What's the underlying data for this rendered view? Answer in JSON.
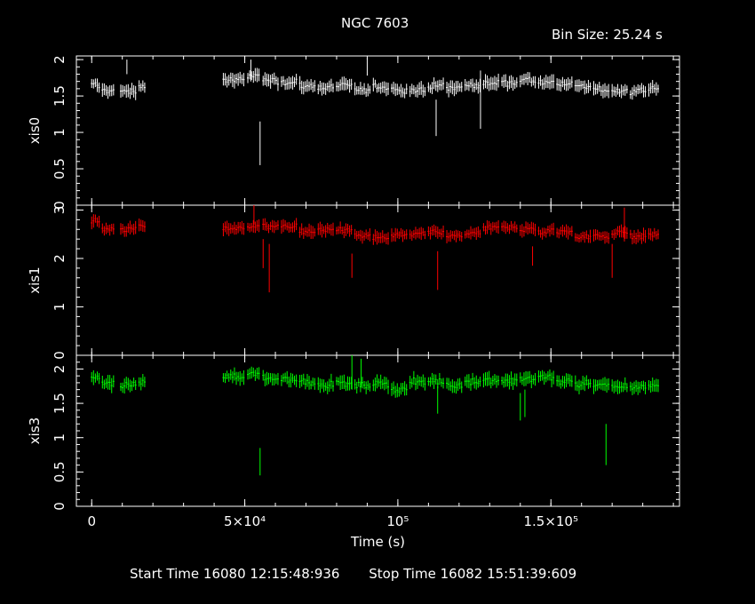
{
  "title": "NGC 7603",
  "bin_size": "Bin Size: 25.24 s",
  "footer": {
    "start_label": "Start Time",
    "start_value": "16080 12:15:48:936",
    "stop_label": "Stop Time",
    "stop_value": "16082 15:51:39:609"
  },
  "colors": {
    "background": "#000000",
    "axes": "#ffffff",
    "xis0": "#ffffff",
    "xis1": "#ff0000",
    "xis3": "#00ff00"
  },
  "chart_data": {
    "type": "scatter",
    "title": "NGC 7603",
    "xlabel": "Time (s)",
    "xlim": [
      -5000,
      192000
    ],
    "x_ticks": [
      {
        "value": 0,
        "label": "0"
      },
      {
        "value": 50000,
        "label": "5×10⁴"
      },
      {
        "value": 100000,
        "label": "10⁵"
      },
      {
        "value": 150000,
        "label": "1.5×10⁵"
      }
    ],
    "gaps": [
      [
        18000,
        42500
      ]
    ],
    "shared_x": true,
    "series": [
      {
        "name": "xis0",
        "color": "#ffffff",
        "ylim": [
          0,
          2.05
        ],
        "y_ticks": [
          "0",
          "0.5",
          "1",
          "1.5",
          "2"
        ],
        "mean": 1.65,
        "noise": 0.09,
        "segments": [
          {
            "x": [
              0,
              2500
            ],
            "y": 1.64
          },
          {
            "x": [
              3500,
              7500
            ],
            "y": 1.58
          },
          {
            "x": [
              9500,
              14500
            ],
            "y": 1.56
          },
          {
            "x": [
              15500,
              17500
            ],
            "y": 1.63
          },
          {
            "x": [
              43000,
              50000
            ],
            "y": 1.72
          },
          {
            "x": [
              51000,
              55000
            ],
            "y": 1.78
          },
          {
            "x": [
              56000,
              61000
            ],
            "y": 1.72
          },
          {
            "x": [
              62000,
              67000
            ],
            "y": 1.7
          },
          {
            "x": [
              68000,
              73000
            ],
            "y": 1.64
          },
          {
            "x": [
              74000,
              79000
            ],
            "y": 1.62
          },
          {
            "x": [
              80000,
              85000
            ],
            "y": 1.64
          },
          {
            "x": [
              86000,
              91000
            ],
            "y": 1.58
          },
          {
            "x": [
              92000,
              97000
            ],
            "y": 1.62
          },
          {
            "x": [
              98000,
              103000
            ],
            "y": 1.6
          },
          {
            "x": [
              104000,
              109000
            ],
            "y": 1.58
          },
          {
            "x": [
              110000,
              115000
            ],
            "y": 1.63
          },
          {
            "x": [
              116000,
              121000
            ],
            "y": 1.62
          },
          {
            "x": [
              122000,
              127000
            ],
            "y": 1.64
          },
          {
            "x": [
              128000,
              133000
            ],
            "y": 1.68
          },
          {
            "x": [
              134000,
              139000
            ],
            "y": 1.7
          },
          {
            "x": [
              140000,
              145000
            ],
            "y": 1.72
          },
          {
            "x": [
              146000,
              151000
            ],
            "y": 1.7
          },
          {
            "x": [
              152000,
              157000
            ],
            "y": 1.68
          },
          {
            "x": [
              158000,
              163000
            ],
            "y": 1.62
          },
          {
            "x": [
              164000,
              169000
            ],
            "y": 1.58
          },
          {
            "x": [
              170000,
              175000
            ],
            "y": 1.58
          },
          {
            "x": [
              176000,
              181000
            ],
            "y": 1.55
          },
          {
            "x": [
              182000,
              185500
            ],
            "y": 1.62
          }
        ],
        "outliers": [
          {
            "x": 55000,
            "y": 0.85,
            "err": 0.3
          },
          {
            "x": 112500,
            "y": 1.2,
            "err": 0.25
          },
          {
            "x": 127000,
            "y": 1.45,
            "err": 0.4
          },
          {
            "x": 11500,
            "y": 1.9,
            "err": 0.1
          },
          {
            "x": 52000,
            "y": 1.85,
            "err": 0.15
          },
          {
            "x": 90000,
            "y": 1.9,
            "err": 0.12
          }
        ]
      },
      {
        "name": "xis1",
        "color": "#ff0000",
        "ylim": [
          0,
          3.1
        ],
        "y_ticks": [
          "0",
          "1",
          "2",
          "3"
        ],
        "mean": 2.6,
        "noise": 0.13,
        "segments": [
          {
            "x": [
              0,
              2500
            ],
            "y": 2.75
          },
          {
            "x": [
              3500,
              7500
            ],
            "y": 2.6
          },
          {
            "x": [
              9500,
              14500
            ],
            "y": 2.62
          },
          {
            "x": [
              15500,
              17500
            ],
            "y": 2.68
          },
          {
            "x": [
              43000,
              50000
            ],
            "y": 2.62
          },
          {
            "x": [
              51000,
              55000
            ],
            "y": 2.65
          },
          {
            "x": [
              56000,
              61000
            ],
            "y": 2.7
          },
          {
            "x": [
              62000,
              67000
            ],
            "y": 2.65
          },
          {
            "x": [
              68000,
              73000
            ],
            "y": 2.55
          },
          {
            "x": [
              74000,
              79000
            ],
            "y": 2.58
          },
          {
            "x": [
              80000,
              85000
            ],
            "y": 2.6
          },
          {
            "x": [
              86000,
              91000
            ],
            "y": 2.45
          },
          {
            "x": [
              92000,
              97000
            ],
            "y": 2.42
          },
          {
            "x": [
              98000,
              103000
            ],
            "y": 2.45
          },
          {
            "x": [
              104000,
              109000
            ],
            "y": 2.5
          },
          {
            "x": [
              110000,
              115000
            ],
            "y": 2.52
          },
          {
            "x": [
              116000,
              121000
            ],
            "y": 2.45
          },
          {
            "x": [
              122000,
              127000
            ],
            "y": 2.5
          },
          {
            "x": [
              128000,
              133000
            ],
            "y": 2.6
          },
          {
            "x": [
              134000,
              139000
            ],
            "y": 2.65
          },
          {
            "x": [
              140000,
              145000
            ],
            "y": 2.6
          },
          {
            "x": [
              146000,
              151000
            ],
            "y": 2.55
          },
          {
            "x": [
              152000,
              157000
            ],
            "y": 2.55
          },
          {
            "x": [
              158000,
              163000
            ],
            "y": 2.45
          },
          {
            "x": [
              164000,
              169000
            ],
            "y": 2.45
          },
          {
            "x": [
              170000,
              175000
            ],
            "y": 2.55
          },
          {
            "x": [
              176000,
              181000
            ],
            "y": 2.45
          },
          {
            "x": [
              182000,
              185500
            ],
            "y": 2.5
          }
        ],
        "outliers": [
          {
            "x": 58000,
            "y": 1.8,
            "err": 0.5
          },
          {
            "x": 56000,
            "y": 2.1,
            "err": 0.3
          },
          {
            "x": 85000,
            "y": 1.85,
            "err": 0.25
          },
          {
            "x": 113000,
            "y": 1.75,
            "err": 0.4
          },
          {
            "x": 144000,
            "y": 2.05,
            "err": 0.2
          },
          {
            "x": 170000,
            "y": 1.95,
            "err": 0.35
          },
          {
            "x": 174000,
            "y": 2.7,
            "err": 0.35
          },
          {
            "x": 53000,
            "y": 2.9,
            "err": 0.2
          }
        ]
      },
      {
        "name": "xis3",
        "color": "#00ff00",
        "ylim": [
          0,
          2.2
        ],
        "y_ticks": [
          "0",
          "0.5",
          "1",
          "1.5",
          "2"
        ],
        "mean": 1.8,
        "noise": 0.1,
        "segments": [
          {
            "x": [
              0,
              2500
            ],
            "y": 1.88
          },
          {
            "x": [
              3500,
              7500
            ],
            "y": 1.78
          },
          {
            "x": [
              9500,
              14500
            ],
            "y": 1.76
          },
          {
            "x": [
              15500,
              17500
            ],
            "y": 1.8
          },
          {
            "x": [
              43000,
              50000
            ],
            "y": 1.88
          },
          {
            "x": [
              51000,
              55000
            ],
            "y": 1.92
          },
          {
            "x": [
              56000,
              61000
            ],
            "y": 1.86
          },
          {
            "x": [
              62000,
              67000
            ],
            "y": 1.85
          },
          {
            "x": [
              68000,
              73000
            ],
            "y": 1.82
          },
          {
            "x": [
              74000,
              79000
            ],
            "y": 1.78
          },
          {
            "x": [
              80000,
              85000
            ],
            "y": 1.8
          },
          {
            "x": [
              86000,
              91000
            ],
            "y": 1.75
          },
          {
            "x": [
              92000,
              97000
            ],
            "y": 1.78
          },
          {
            "x": [
              98000,
              103000
            ],
            "y": 1.72
          },
          {
            "x": [
              104000,
              109000
            ],
            "y": 1.8
          },
          {
            "x": [
              110000,
              115000
            ],
            "y": 1.82
          },
          {
            "x": [
              116000,
              121000
            ],
            "y": 1.78
          },
          {
            "x": [
              122000,
              127000
            ],
            "y": 1.82
          },
          {
            "x": [
              128000,
              133000
            ],
            "y": 1.85
          },
          {
            "x": [
              134000,
              139000
            ],
            "y": 1.82
          },
          {
            "x": [
              140000,
              145000
            ],
            "y": 1.85
          },
          {
            "x": [
              146000,
              151000
            ],
            "y": 1.88
          },
          {
            "x": [
              152000,
              157000
            ],
            "y": 1.82
          },
          {
            "x": [
              158000,
              163000
            ],
            "y": 1.78
          },
          {
            "x": [
              164000,
              169000
            ],
            "y": 1.78
          },
          {
            "x": [
              170000,
              175000
            ],
            "y": 1.72
          },
          {
            "x": [
              176000,
              181000
            ],
            "y": 1.74
          },
          {
            "x": [
              182000,
              185500
            ],
            "y": 1.76
          }
        ],
        "outliers": [
          {
            "x": 55000,
            "y": 0.65,
            "err": 0.2
          },
          {
            "x": 168000,
            "y": 0.9,
            "err": 0.3
          },
          {
            "x": 140000,
            "y": 1.45,
            "err": 0.2
          },
          {
            "x": 141500,
            "y": 1.5,
            "err": 0.2
          },
          {
            "x": 113000,
            "y": 1.55,
            "err": 0.2
          },
          {
            "x": 85000,
            "y": 1.95,
            "err": 0.25
          },
          {
            "x": 88000,
            "y": 1.95,
            "err": 0.2
          }
        ]
      }
    ]
  }
}
